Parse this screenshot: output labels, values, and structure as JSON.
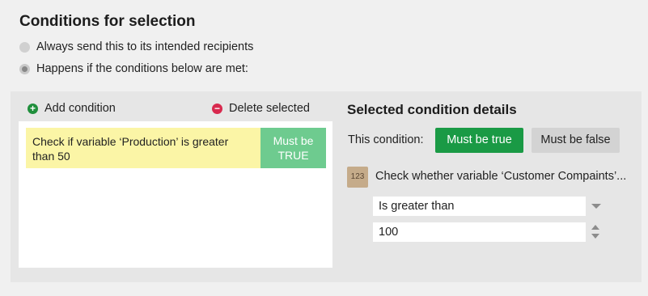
{
  "header": {
    "title": "Conditions for selection"
  },
  "mode_options": [
    {
      "label": "Always send this to its intended recipients",
      "selected": false
    },
    {
      "label": "Happens if the conditions below are met:",
      "selected": true
    }
  ],
  "toolbar": {
    "add_label": "Add condition",
    "add_icon": "plus-circle-icon",
    "delete_label": "Delete selected",
    "delete_icon": "minus-circle-icon"
  },
  "conditions": [
    {
      "text": "Check if variable ‘Production’ is greater than 50",
      "badge_line1": "Must be",
      "badge_line2": "TRUE"
    }
  ],
  "details": {
    "title": "Selected condition details",
    "this_condition_label": "This condition:",
    "must_be_true_label": "Must be true",
    "must_be_false_label": "Must be false",
    "type_icon_text": "123",
    "check_text": "Check whether variable ‘Customer Compaints’...",
    "operator_value": "Is greater than",
    "number_value": "100"
  },
  "colors": {
    "accent_green": "#1a9a45",
    "badge_green": "#6ecb8f",
    "condition_highlight": "#fbf5a6",
    "delete_red": "#d8294e"
  }
}
